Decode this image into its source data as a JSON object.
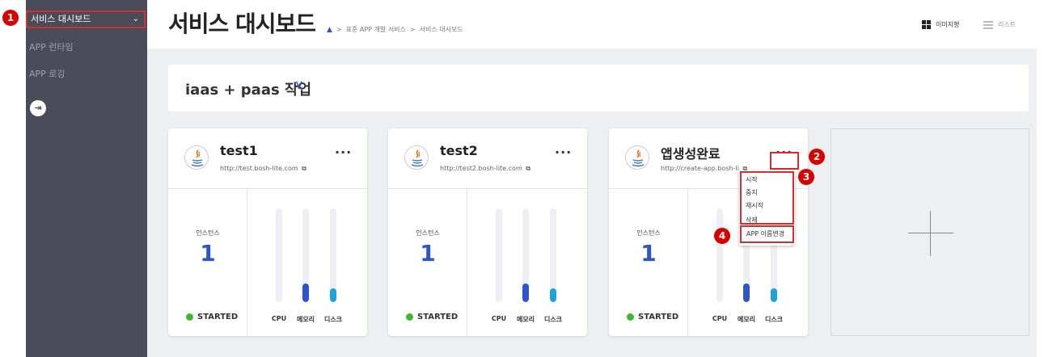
{
  "sidebar": {
    "items": [
      {
        "label": "서비스 대시보드"
      },
      {
        "label": "APP 런타임"
      },
      {
        "label": "APP 로깅"
      }
    ],
    "active_chevron": "⌄",
    "exit_icon": "logout-icon"
  },
  "header": {
    "title": "서비스 대시보드",
    "breadcrumb": [
      "표준 APP 개발 서비스",
      "서비스 대시보드"
    ],
    "breadcrumb_sep": ">",
    "view_image_label": "이미지형",
    "view_list_label": "리스트"
  },
  "org": {
    "name": "iaas + paas 작업",
    "chevron": "∨"
  },
  "apps": [
    {
      "name": "test1",
      "url": "http://test.bosh-lite.com",
      "instance_label": "인스턴스",
      "instances": "1",
      "status": "STARTED",
      "cpu_label": "CPU",
      "mem_label": "메모리",
      "disk_label": "디스크",
      "cpu": 0,
      "mem": 0.2,
      "disk": 0.15
    },
    {
      "name": "test2",
      "url": "http://test2.bosh-lite.com",
      "instance_label": "인스턴스",
      "instances": "1",
      "status": "STARTED",
      "cpu_label": "CPU",
      "mem_label": "메모리",
      "disk_label": "디스크",
      "cpu": 0,
      "mem": 0.2,
      "disk": 0.15
    },
    {
      "name": "앱생성완료",
      "url": "http://create-app.bosh-li",
      "instance_label": "인스턴스",
      "instances": "1",
      "status": "STARTED",
      "cpu_label": "CPU",
      "mem_label": "메모리",
      "disk_label": "디스크",
      "cpu": 0,
      "mem": 0.2,
      "disk": 0.15
    }
  ],
  "more_label": "···",
  "menu": {
    "items": [
      "시작",
      "중지",
      "재시작",
      "삭제"
    ],
    "rename": "APP 이름변경"
  },
  "callouts": [
    "1",
    "2",
    "3",
    "4"
  ],
  "colors": {
    "sidebar_bg": "#4a4d59",
    "accent_blue": "#2d55c8",
    "status_green": "#3db833",
    "mem_bar": "#2d55c8",
    "disk_bar": "#1fa3d6",
    "callout_red": "#d90000",
    "highlight_red": "#d32f2f"
  }
}
